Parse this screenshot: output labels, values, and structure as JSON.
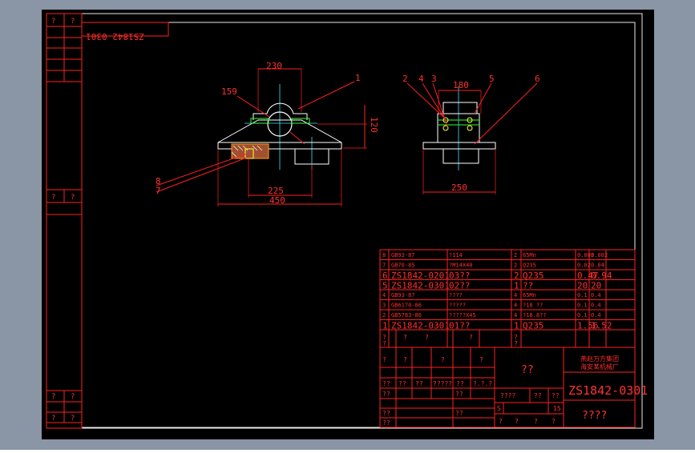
{
  "colors": {
    "frame_bg": "#8a96a6",
    "paper": "#000000",
    "border": "#e8e8e8",
    "line": "#ff2020",
    "dim_text": "#ff3030",
    "white": "#ffffff",
    "green": "#30ff30",
    "yellow": "#ffff40",
    "cyan": "#40e0ff",
    "orange": "#ffa000",
    "brown": "#a05030"
  },
  "title_block": {
    "mirrored_code": "ZS1842-0301",
    "drawing_number": "ZS1842-0301",
    "company_line1": "燕赵万方集团",
    "company_line2": "海安某机械厂",
    "center_mark": "??",
    "bottom_mark": "????"
  },
  "left_strip": {
    "top": [
      "?",
      "?"
    ],
    "mid": [
      "?",
      "?"
    ],
    "bottom1": [
      "?",
      "?"
    ],
    "bottom2": [
      "?",
      "?"
    ]
  },
  "views": {
    "front": {
      "dim_top": "230",
      "dim_radius": "159",
      "dim_height": "120",
      "dim_inner": "225",
      "dim_total": "450",
      "leader_1": "1",
      "leader_8": "8",
      "leader_7": "7"
    },
    "side": {
      "dim_top": "180",
      "dim_bottom": "250",
      "leader_2": "2",
      "leader_4": "4",
      "leader_3": "3",
      "leader_5": "5",
      "leader_6": "6"
    }
  },
  "parts_list": [
    {
      "no": "8",
      "code": "GB93-87",
      "name": "?114",
      "qty": "2",
      "material": "65Mn",
      "w1": "0.003",
      "w2": "0.002",
      "big": false
    },
    {
      "no": "7",
      "code": "GB70-85",
      "name": "?M14X40",
      "qty": "2",
      "material": "Q235",
      "w1": "0.02",
      "w2": "0.04",
      "big": false
    },
    {
      "no": "6",
      "code": "ZS1842-0201",
      "name": "03??",
      "qty": "2",
      "material": "Q235",
      "w1": "0.47",
      "w2": "0.94",
      "big": true
    },
    {
      "no": "5",
      "code": "ZS1842-0301",
      "name": "02??",
      "qty": "1",
      "material": "??",
      "w1": "20",
      "w2": "20",
      "big": true
    },
    {
      "no": "4",
      "code": "GB93-87",
      "name": "????",
      "qty": "4",
      "material": "65Mn",
      "w1": "0.1",
      "w2": "0.4",
      "big": false
    },
    {
      "no": "3",
      "code": "GB6170-86",
      "name": "?????",
      "qty": "4",
      "material": "?18 ??",
      "w1": "0.1",
      "w2": "0.4",
      "big": false
    },
    {
      "no": "2",
      "code": "GB5783-86",
      "name": "?????X45",
      "qty": "4",
      "material": "?18.8??",
      "w1": "0.1",
      "w2": "0.4",
      "big": false
    },
    {
      "no": "1",
      "code": "ZS1842-0301",
      "name": "01??",
      "qty": "1",
      "material": "Q235",
      "w1": "1.56",
      "w2": "1.52",
      "big": true
    }
  ],
  "header_row": [
    "?",
    "?",
    "?",
    "?",
    "?",
    "?",
    "?"
  ],
  "sign_rows": {
    "row_a": [
      "?",
      "?",
      "?",
      "?"
    ],
    "row_b": [
      "??",
      "??",
      "??",
      "?????",
      "??",
      "?.?.?"
    ],
    "row_c": [
      "??",
      "??"
    ],
    "row_d": [
      "??",
      "??"
    ],
    "row_e": [
      "??"
    ],
    "scale_row": [
      "????",
      "??",
      "??"
    ],
    "sheet_row": [
      "S",
      "15"
    ],
    "page_row": [
      "?",
      "?",
      "?",
      "?"
    ]
  }
}
